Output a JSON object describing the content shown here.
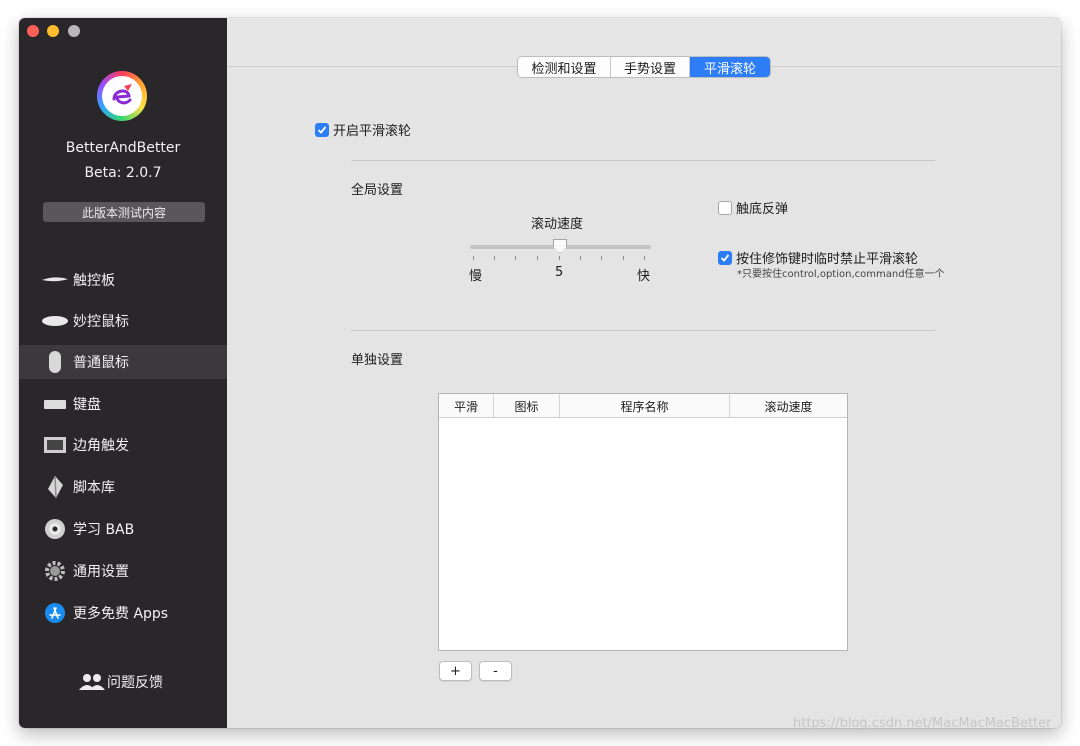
{
  "sidebar": {
    "app_name": "BetterAndBetter",
    "version": "Beta:  2.0.7",
    "beta_button": "此版本测试内容",
    "items": [
      {
        "label": "触控板",
        "icon": "trackpad-icon"
      },
      {
        "label": "妙控鼠标",
        "icon": "magic-mouse-icon"
      },
      {
        "label": "普通鼠标",
        "icon": "mouse-icon"
      },
      {
        "label": "键盘",
        "icon": "keyboard-icon"
      },
      {
        "label": "边角触发",
        "icon": "hot-corner-icon"
      },
      {
        "label": "脚本库",
        "icon": "script-icon"
      },
      {
        "label": "学习 BAB",
        "icon": "dvd-icon"
      },
      {
        "label": "通用设置",
        "icon": "gear-icon"
      },
      {
        "label": "更多免费 Apps",
        "icon": "app-store-icon"
      }
    ],
    "active_index": 2,
    "feedback": "问题反馈"
  },
  "tabs": [
    "检测和设置",
    "手势设置",
    "平滑滚轮"
  ],
  "active_tab": 2,
  "main": {
    "enable_smooth_scroll": {
      "label": "开启平滑滚轮",
      "checked": true
    },
    "global_settings": "全局设置",
    "scroll_speed": {
      "label": "滚动速度",
      "min_label": "慢",
      "max_label": "快",
      "value": "5"
    },
    "bounce": {
      "label": "触底反弹",
      "checked": false
    },
    "hold_modifier": {
      "label": "按住修饰键时临时禁止平滑滚轮",
      "checked": true,
      "note": "*只要按住control,option,command任意一个"
    },
    "individual_settings": "单独设置",
    "table": {
      "columns": [
        "平滑",
        "图标",
        "程序名称",
        "滚动速度"
      ],
      "rows": []
    },
    "add_button": "+",
    "remove_button": "-"
  },
  "watermark": "https://blog.csdn.net/MacMacMacBetter",
  "colors": {
    "accent": "#2d7df6",
    "sidebar_bg": "#2a272a",
    "main_bg": "#e4e4e4"
  }
}
